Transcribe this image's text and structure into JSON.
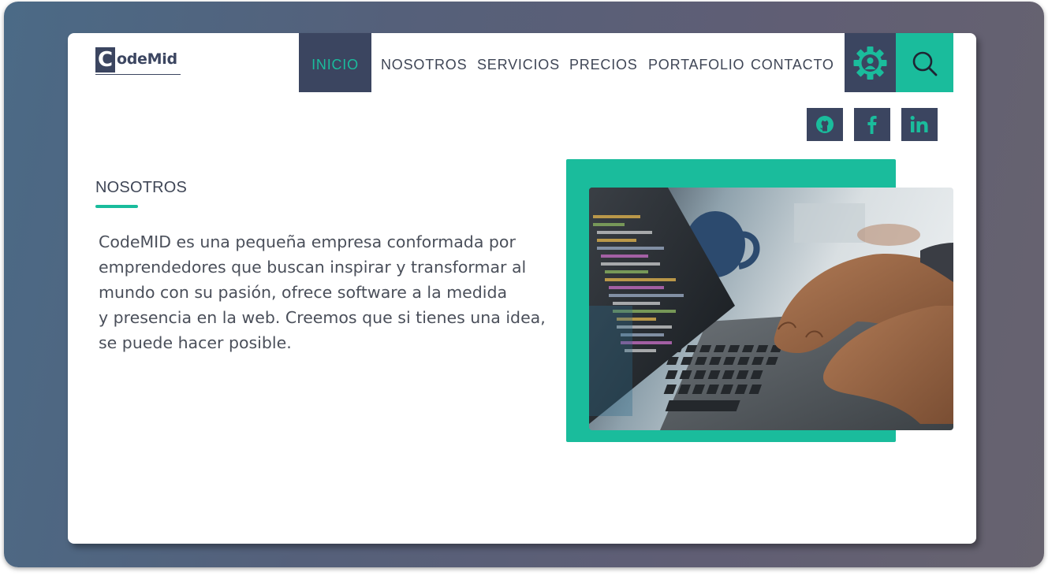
{
  "logo": {
    "initial": "C",
    "rest": "odeMid"
  },
  "nav": {
    "items": [
      {
        "label": "INICIO",
        "active": true
      },
      {
        "label": "NOSOTROS"
      },
      {
        "label": "SERVICIOS"
      },
      {
        "label": "PRECIOS"
      },
      {
        "label": "PORTAFOLIO"
      },
      {
        "label": "CONTACTO"
      }
    ],
    "gear_icon": "gear-user-icon",
    "search_icon": "search-icon"
  },
  "social": [
    "github-icon",
    "facebook-icon",
    "linkedin-icon"
  ],
  "about": {
    "title": "NOSOTROS",
    "lines": [
      "CodeMID es una pequeña empresa conformada por",
      "emprendedores que buscan inspirar y transformar al",
      "mundo con su pasión, ofrece software a la medida",
      "y presencia en la web. Creemos que si tienes una idea,",
      "se puede hacer posible."
    ]
  },
  "colors": {
    "accent": "#1abc9c",
    "navy": "#3b4560",
    "text": "#4a4f5a"
  }
}
